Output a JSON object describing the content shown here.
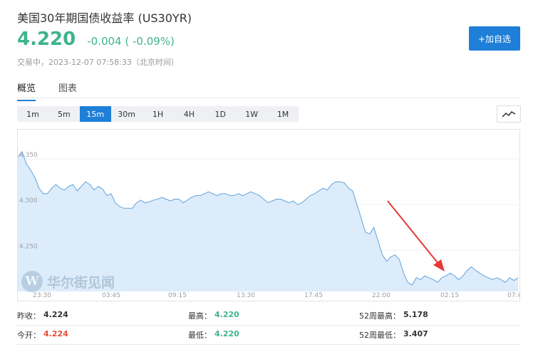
{
  "header": {
    "title": "美国30年期国债收益率 (US30YR)",
    "price": "4.220",
    "change": "-0.004 ( -0.09%)",
    "status": "交易中，2023-12-07 07:58:33（北京时间）",
    "follow_label": "+加自选"
  },
  "tabs": [
    {
      "label": "概览",
      "active": true
    },
    {
      "label": "图表",
      "active": false
    }
  ],
  "periods": [
    {
      "label": "1m",
      "active": false
    },
    {
      "label": "5m",
      "active": false
    },
    {
      "label": "15m",
      "active": true
    },
    {
      "label": "30m",
      "active": false
    },
    {
      "label": "1H",
      "active": false
    },
    {
      "label": "4H",
      "active": false
    },
    {
      "label": "1D",
      "active": false
    },
    {
      "label": "1W",
      "active": false
    },
    {
      "label": "1M",
      "active": false
    }
  ],
  "chart_toggle_icon": "line-chart-icon",
  "watermark": {
    "logo": "W",
    "text": "华尔街见闻"
  },
  "colors": {
    "up": "#3eb489",
    "down": "#e74c3c",
    "accent": "#1e7fd8",
    "line": "#5fa3dd",
    "fill": "#ddecfa",
    "arrow": "#e53935"
  },
  "chart_data": {
    "type": "area",
    "x_ticks": [
      "23:30",
      "03:45",
      "09:15",
      "13:30",
      "17:45",
      "22:00",
      "02:15",
      "07:4"
    ],
    "y_ticks": [
      4.35,
      4.3,
      4.25
    ],
    "y_tick_labels": [
      "4.350",
      "4.300",
      "4.250"
    ],
    "ylim": [
      4.205,
      4.375
    ],
    "series": [
      {
        "values": [
          4.352,
          4.358,
          4.345,
          4.338,
          4.33,
          4.318,
          4.312,
          4.312,
          4.318,
          4.322,
          4.318,
          4.316,
          4.32,
          4.322,
          4.315,
          4.32,
          4.325,
          4.322,
          4.316,
          4.32,
          4.317,
          4.31,
          4.312,
          4.302,
          4.298,
          4.296,
          4.296,
          4.296,
          4.302,
          4.305,
          4.302,
          4.303,
          4.305,
          4.306,
          4.308,
          4.306,
          4.304,
          4.306,
          4.306,
          4.302,
          4.305,
          4.308,
          4.31,
          4.31,
          4.312,
          4.314,
          4.312,
          4.31,
          4.312,
          4.312,
          4.31,
          4.31,
          4.312,
          4.31,
          4.312,
          4.314,
          4.312,
          4.31,
          4.306,
          4.302,
          4.304,
          4.306,
          4.306,
          4.304,
          4.302,
          4.304,
          4.3,
          4.302,
          4.306,
          4.31,
          4.312,
          4.315,
          4.318,
          4.316,
          4.322,
          4.325,
          4.325,
          4.324,
          4.318,
          4.315,
          4.3,
          4.285,
          4.27,
          4.268,
          4.275,
          4.26,
          4.245,
          4.238,
          4.243,
          4.245,
          4.24,
          4.225,
          4.215,
          4.212,
          4.22,
          4.218,
          4.222,
          4.22,
          4.218,
          4.215,
          4.22,
          4.222,
          4.225,
          4.222,
          4.218,
          4.222,
          4.228,
          4.232,
          4.228,
          4.225,
          4.222,
          4.22,
          4.218,
          4.22,
          4.218,
          4.215,
          4.22,
          4.217,
          4.22
        ]
      }
    ]
  },
  "stats": [
    [
      {
        "label": "昨收：",
        "value": "4.224",
        "tone": "neutral"
      },
      {
        "label": "最高：",
        "value": "4.220",
        "tone": "up"
      },
      {
        "label": "52周最高：",
        "value": "5.178",
        "tone": "neutral"
      }
    ],
    [
      {
        "label": "今开：",
        "value": "4.224",
        "tone": "down"
      },
      {
        "label": "最低：",
        "value": "4.220",
        "tone": "up"
      },
      {
        "label": "52周最低：",
        "value": "3.407",
        "tone": "neutral"
      }
    ]
  ]
}
